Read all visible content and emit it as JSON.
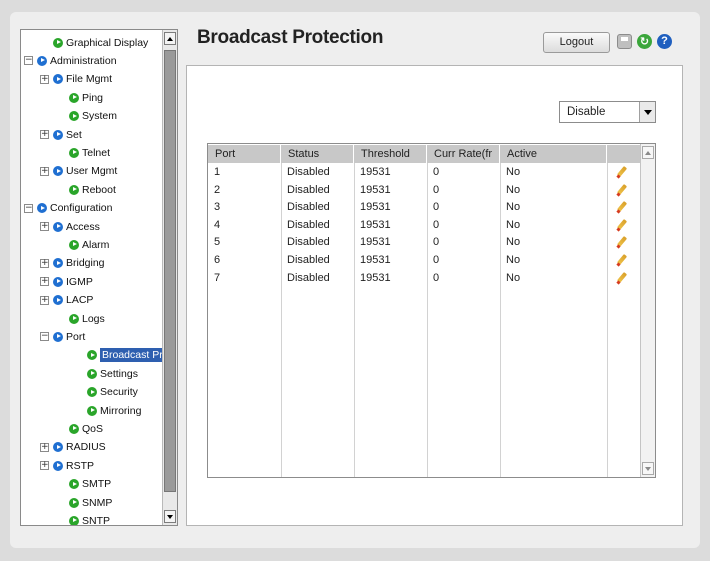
{
  "page": {
    "title": "Broadcast Protection"
  },
  "header": {
    "logout_label": "Logout",
    "help_glyph": "?",
    "refresh_glyph": "↻"
  },
  "sidebar": {
    "items": [
      {
        "label": "Graphical Display",
        "icon": "green-arrow-icon",
        "selected": false
      },
      {
        "label": "Administration",
        "icon": "blue-arrow-icon",
        "expander": "−"
      },
      {
        "label": "File Mgmt",
        "icon": "blue-arrow-icon",
        "expander": "+"
      },
      {
        "label": "Ping",
        "icon": "green-arrow-icon"
      },
      {
        "label": "System",
        "icon": "green-arrow-icon"
      },
      {
        "label": "Set",
        "icon": "blue-arrow-icon",
        "expander": "+"
      },
      {
        "label": "Telnet",
        "icon": "green-arrow-icon"
      },
      {
        "label": "User Mgmt",
        "icon": "blue-arrow-icon",
        "expander": "+"
      },
      {
        "label": "Reboot",
        "icon": "green-arrow-icon"
      },
      {
        "label": "Configuration",
        "icon": "blue-arrow-icon",
        "expander": "−"
      },
      {
        "label": "Access",
        "icon": "blue-arrow-icon",
        "expander": "+"
      },
      {
        "label": "Alarm",
        "icon": "green-arrow-icon"
      },
      {
        "label": "Bridging",
        "icon": "blue-arrow-icon",
        "expander": "+"
      },
      {
        "label": "IGMP",
        "icon": "blue-arrow-icon",
        "expander": "+"
      },
      {
        "label": "LACP",
        "icon": "blue-arrow-icon",
        "expander": "+"
      },
      {
        "label": "Logs",
        "icon": "green-arrow-icon"
      },
      {
        "label": "Port",
        "icon": "blue-arrow-icon",
        "expander": "−"
      },
      {
        "label": "Broadcast Protect",
        "icon": "green-arrow-icon",
        "selected": true
      },
      {
        "label": "Settings",
        "icon": "green-arrow-icon"
      },
      {
        "label": "Security",
        "icon": "green-arrow-icon"
      },
      {
        "label": "Mirroring",
        "icon": "green-arrow-icon"
      },
      {
        "label": "QoS",
        "icon": "green-arrow-icon"
      },
      {
        "label": "RADIUS",
        "icon": "blue-arrow-icon",
        "expander": "+"
      },
      {
        "label": "RSTP",
        "icon": "blue-arrow-icon",
        "expander": "+"
      },
      {
        "label": "SMTP",
        "icon": "green-arrow-icon"
      },
      {
        "label": "SNMP",
        "icon": "green-arrow-icon"
      },
      {
        "label": "SNTP",
        "icon": "green-arrow-icon"
      }
    ]
  },
  "filter": {
    "selected": "Disable"
  },
  "table": {
    "columns": [
      "Port",
      "Status",
      "Threshold",
      "Curr Rate(fr",
      "Active"
    ],
    "rows": [
      [
        "1",
        "Disabled",
        "19531",
        "0",
        "No"
      ],
      [
        "2",
        "Disabled",
        "19531",
        "0",
        "No"
      ],
      [
        "3",
        "Disabled",
        "19531",
        "0",
        "No"
      ],
      [
        "4",
        "Disabled",
        "19531",
        "0",
        "No"
      ],
      [
        "5",
        "Disabled",
        "19531",
        "0",
        "No"
      ],
      [
        "6",
        "Disabled",
        "19531",
        "0",
        "No"
      ],
      [
        "7",
        "Disabled",
        "19531",
        "0",
        "No"
      ]
    ],
    "row_action_icon": "pencil-edit-icon"
  },
  "colors": {
    "selected_bg": "#2e5fb0",
    "header_bg": "#c8c8c8",
    "help_icon": "#1f5fbf",
    "refresh_icon": "#3ba63b"
  }
}
